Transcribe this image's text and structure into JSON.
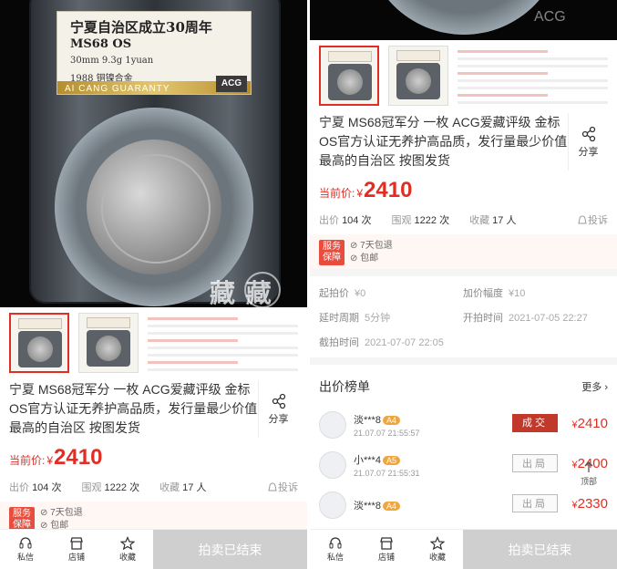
{
  "hero": {
    "label_title": "宁夏自治区成立30周年",
    "label_grade": "MS68 OS",
    "label_spec": "30mm 9.3g 1yuan",
    "label_year": "1988  铜镍合金",
    "label_strip": "AI CANG GUARANTY",
    "label_brand": "ACG",
    "watermark": "藏 藏"
  },
  "product": {
    "title": "宁夏 MS68冠军分 一枚 ACG爱藏评级 金标OS官方认证无养护高品质，发行量最少价值最高的自治区 按图发货",
    "share_label": "分享",
    "price_label": "当前价:",
    "price_symbol": "¥",
    "price_value": "2410",
    "bids_label": "出价",
    "bids_count": "104 次",
    "views_label": "围观",
    "views_count": "1222 次",
    "fav_label": "收藏",
    "fav_count": "17 人",
    "report_label": "投诉"
  },
  "service": {
    "tag": "服务保障",
    "items": [
      "7天包退",
      "包邮"
    ]
  },
  "auction": {
    "start_label": "起拍价",
    "start_value": "¥0",
    "incr_label": "加价幅度",
    "incr_value": "¥10",
    "delay_label": "延时周期",
    "delay_value": "5分钟",
    "open_label": "开拍时间",
    "open_value": "2021-07-05 22:27",
    "close_label": "截拍时间",
    "close_value": "2021-07-07 22:05"
  },
  "bids": {
    "heading": "出价榜单",
    "more": "更多",
    "rows": [
      {
        "user": "淡***8",
        "level": "A4",
        "time": "21.07.07 21:55:57",
        "status": "成交",
        "price": "2410"
      },
      {
        "user": "小***4",
        "level": "A5",
        "time": "21.07.07 21:55:31",
        "status": "出局",
        "price": "2400"
      },
      {
        "user": "淡***8",
        "level": "A4",
        "time": "",
        "status": "出局",
        "price": "2330"
      }
    ],
    "top_label": "顶部"
  },
  "bottom": {
    "msg": "私信",
    "shop": "店铺",
    "fav": "收藏",
    "ended": "拍卖已结束"
  }
}
